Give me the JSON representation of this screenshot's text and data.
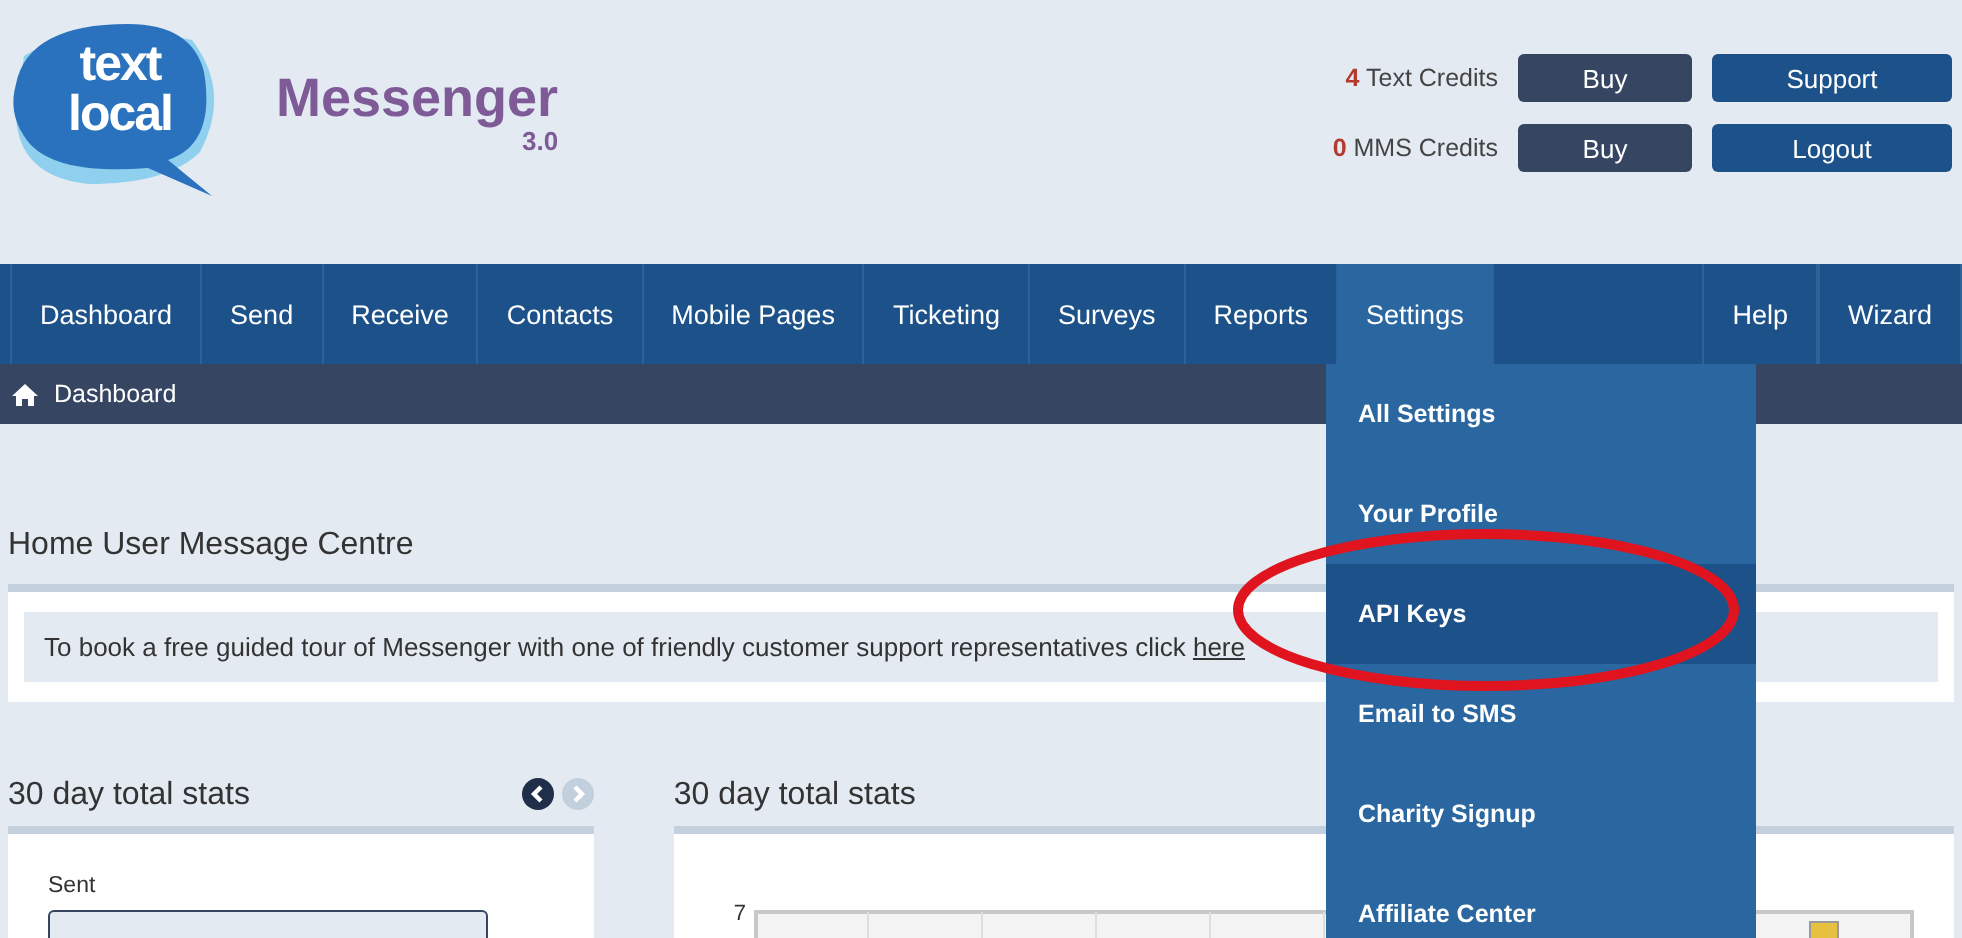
{
  "logo": {
    "line_1": "text",
    "line_2": "local"
  },
  "product": {
    "name": "Messenger",
    "version": "3.0"
  },
  "credits": [
    {
      "count": "4",
      "label": "Text Credits",
      "button": "Buy"
    },
    {
      "count": "0",
      "label": "MMS Credits",
      "button": "Buy"
    }
  ],
  "account_buttons": [
    "Support",
    "Logout"
  ],
  "nav": [
    {
      "label": "Dashboard",
      "selected": false
    },
    {
      "label": "Send",
      "selected": false
    },
    {
      "label": "Receive",
      "selected": false
    },
    {
      "label": "Contacts",
      "selected": false
    },
    {
      "label": "Mobile Pages",
      "selected": false
    },
    {
      "label": "Ticketing",
      "selected": false
    },
    {
      "label": "Surveys",
      "selected": false
    },
    {
      "label": "Reports",
      "selected": false
    },
    {
      "label": "Settings",
      "selected": true
    }
  ],
  "nav_right": [
    "Help",
    "Wizard"
  ],
  "breadcrumb": "Dashboard",
  "settings_menu": [
    {
      "label": "All Settings",
      "selected": false
    },
    {
      "label": "Your Profile",
      "selected": false
    },
    {
      "label": "API Keys",
      "selected": true
    },
    {
      "label": "Email to SMS",
      "selected": false
    },
    {
      "label": "Charity Signup",
      "selected": false
    },
    {
      "label": "Affiliate Center",
      "selected": false
    }
  ],
  "page_title": "Home User Message Centre",
  "notice": {
    "text": "To book a free guided tour of Messenger with one of friendly customer support representatives click ",
    "link": "here"
  },
  "stats_left": {
    "title": "30 day total stats",
    "field_label": "Sent"
  },
  "stats_right": {
    "title": "30 day total stats",
    "y_tick": "7"
  }
}
